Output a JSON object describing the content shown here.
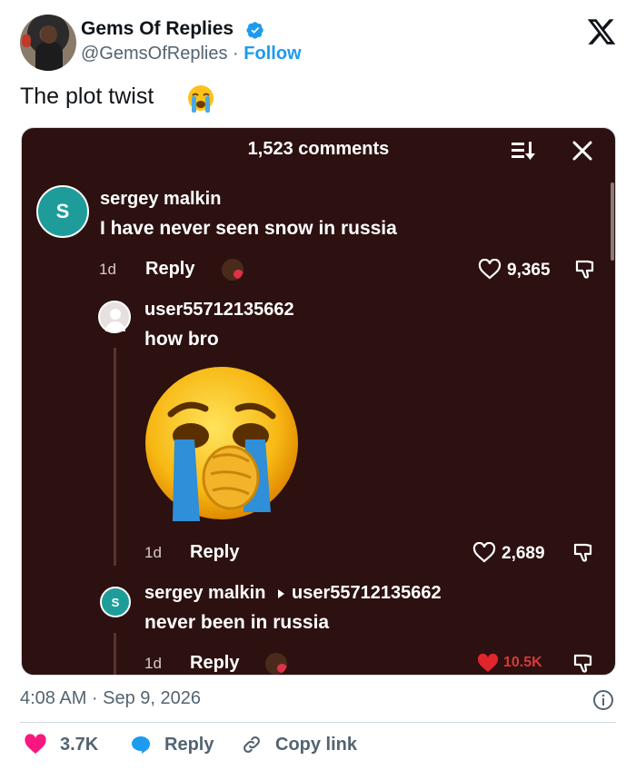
{
  "header": {
    "display_name": "Gems Of Replies",
    "handle": "@GemsOfReplies",
    "separator": "·",
    "follow_label": "Follow"
  },
  "tweet": {
    "text": "The plot twist",
    "emoji": "loudly-crying-face"
  },
  "media": {
    "title": "1,523 comments",
    "comments": [
      {
        "avatar_letter": "S",
        "user": "sergey malkin",
        "text": "I have never seen snow in russia",
        "time": "1d",
        "reply_label": "Reply",
        "likes": "9,365"
      },
      {
        "user": "user55712135662",
        "text": "how bro",
        "time": "1d",
        "reply_label": "Reply",
        "likes": "2,689"
      },
      {
        "avatar_letter": "S",
        "user": "sergey malkin",
        "reply_to": "user55712135662",
        "text": "never been in russia",
        "time": "1d",
        "reply_label": "Reply",
        "likes": "10.5K"
      }
    ]
  },
  "footer": {
    "timestamp": "4:08 AM · Sep 9, 2026",
    "likes": "3.7K",
    "reply_label": "Reply",
    "copy_label": "Copy link"
  },
  "colors": {
    "accent": "#1d9bf0",
    "like": "#f91880",
    "media_bg": "#2c1110",
    "avatar_teal": "#1e9c9a"
  }
}
